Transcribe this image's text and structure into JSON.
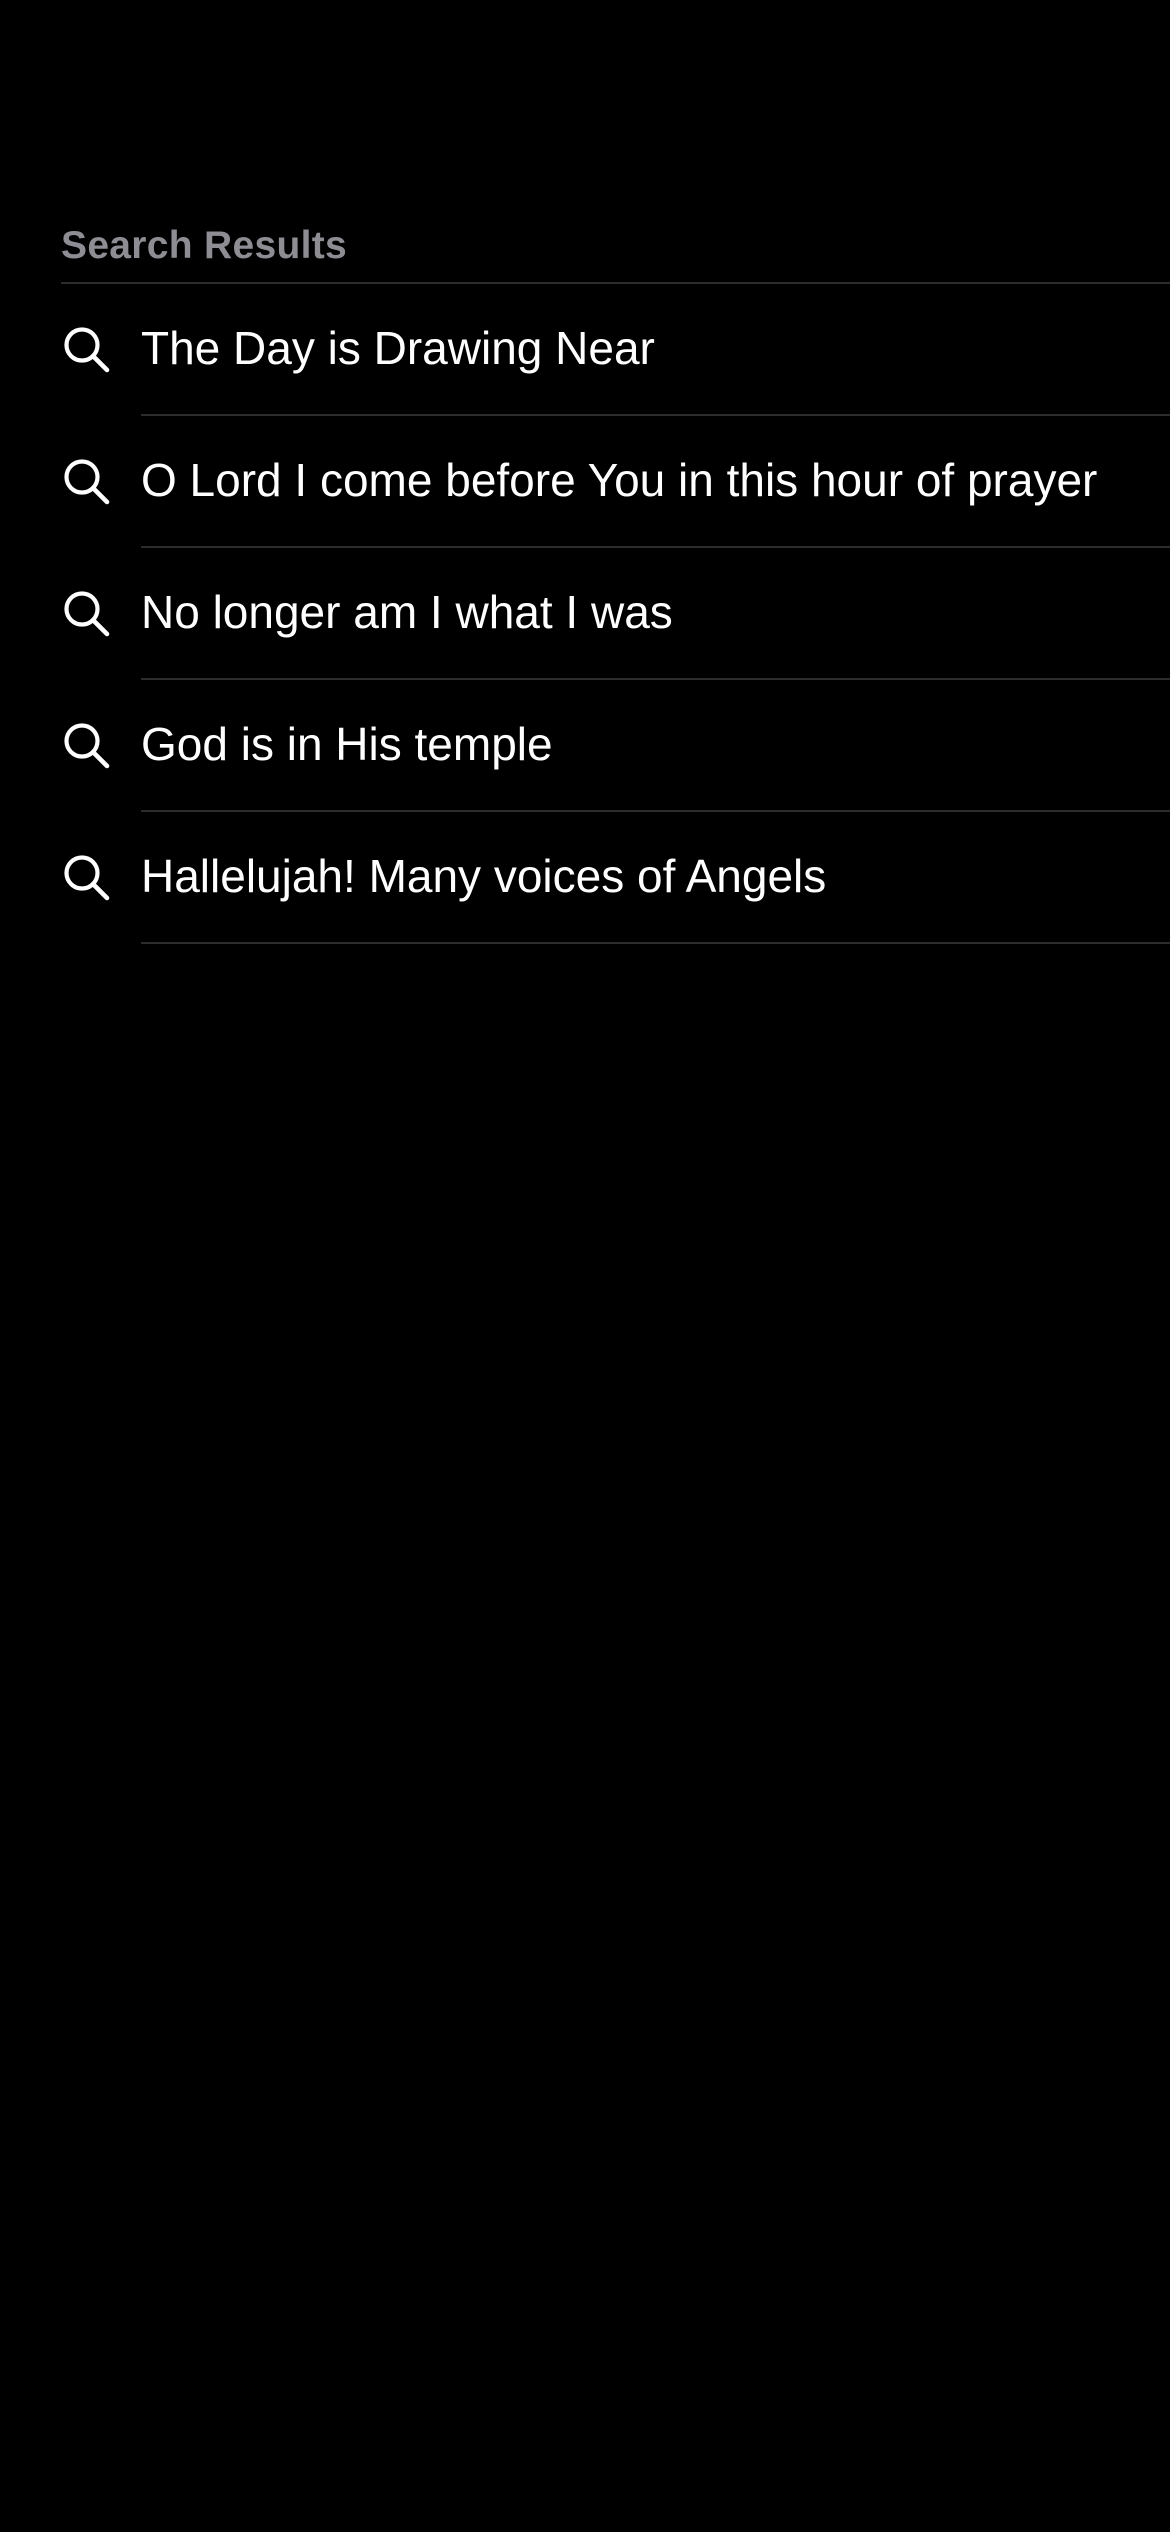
{
  "section": {
    "header": "Search Results"
  },
  "results": [
    {
      "label": "The Day is Drawing Near",
      "icon": "search-icon"
    },
    {
      "label": "O Lord I come before You in this hour of prayer",
      "icon": "search-icon"
    },
    {
      "label": "No longer am I what I was",
      "icon": "search-icon"
    },
    {
      "label": "God is in His temple",
      "icon": "search-icon"
    },
    {
      "label": "Hallelujah! Many voices of Angels",
      "icon": "search-icon"
    }
  ],
  "colors": {
    "background": "#000000",
    "header_text": "#8d8d93",
    "row_text": "#ffffff",
    "separator": "#2c2c2e"
  }
}
